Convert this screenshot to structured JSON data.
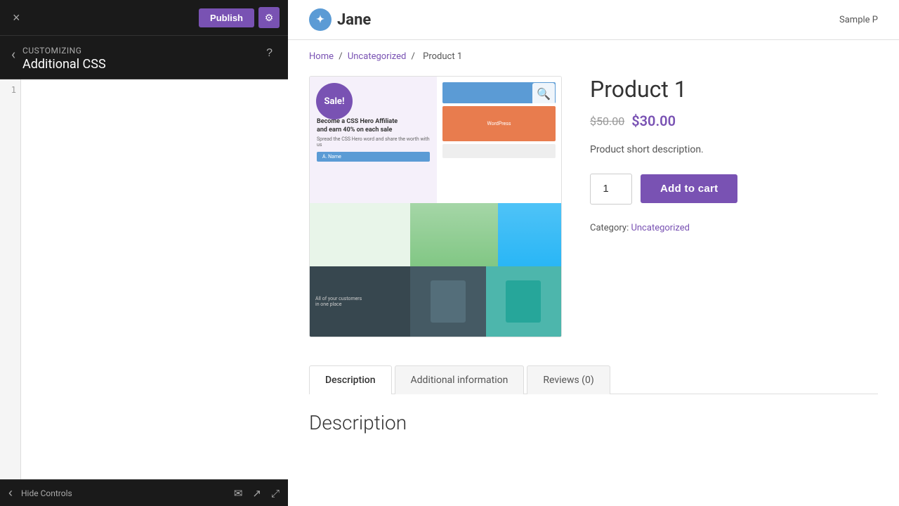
{
  "leftPanel": {
    "closeBtn": "×",
    "publishLabel": "Publish",
    "customizingLabel": "Customizing",
    "title": "Additional CSS",
    "helpTitle": "?",
    "lineNumber": "1",
    "cssPlaceholder": "",
    "hideControlsLabel": "Hide Controls"
  },
  "siteHeader": {
    "logoText": "Jane",
    "sampleMenu": "Sample P"
  },
  "breadcrumb": {
    "home": "Home",
    "separator1": "/",
    "uncategorized": "Uncategorized",
    "separator2": "/",
    "product": "Product 1"
  },
  "product": {
    "title": "Product 1",
    "priceOld": "$50.00",
    "priceNew": "$30.00",
    "shortDesc": "Product short description.",
    "quantity": "1",
    "addToCartLabel": "Add to cart",
    "categoryLabel": "Category:",
    "categoryValue": "Uncategorized",
    "saleBadge": "Sale!"
  },
  "tabs": [
    {
      "label": "Description",
      "active": true
    },
    {
      "label": "Additional information",
      "active": false
    },
    {
      "label": "Reviews (0)",
      "active": false
    }
  ],
  "tabContent": {
    "descriptionTitle": "Description"
  }
}
